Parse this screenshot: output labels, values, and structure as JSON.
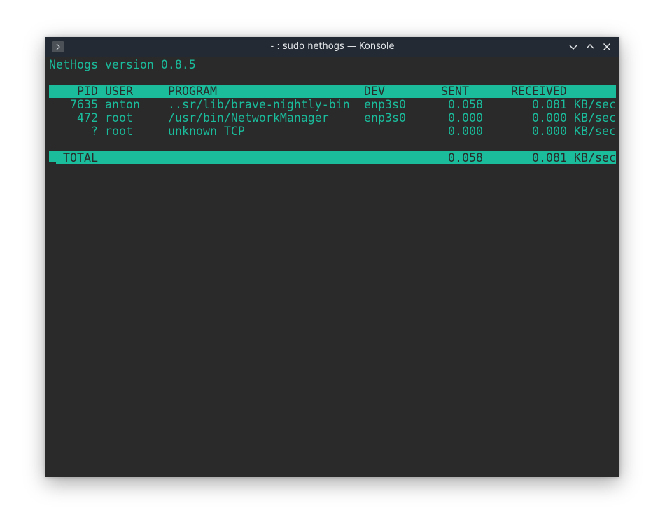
{
  "window": {
    "title": "- : sudo nethogs — Konsole",
    "accent": "#1abc9c",
    "background": "#2a2a2a",
    "titlebar_color": "#232a33"
  },
  "icons": {
    "app": "terminal-prompt-icon",
    "minimize": "chevron-down-icon",
    "maximize": "chevron-up-icon",
    "close": "close-icon"
  },
  "terminal": {
    "version_line": "NetHogs version 0.8.5",
    "headers": {
      "pid": "PID",
      "user": "USER",
      "program": "PROGRAM",
      "dev": "DEV",
      "sent": "SENT",
      "received": "RECEIVED"
    },
    "rows": [
      {
        "pid": "7635",
        "user": "anton",
        "program": "..sr/lib/brave-nightly-bin",
        "dev": "enp3s0",
        "sent": "0.058",
        "received": "0.081",
        "unit": "KB/sec"
      },
      {
        "pid": "472",
        "user": "root",
        "program": "/usr/bin/NetworkManager",
        "dev": "enp3s0",
        "sent": "0.000",
        "received": "0.000",
        "unit": "KB/sec"
      },
      {
        "pid": "?",
        "user": "root",
        "program": "unknown TCP",
        "dev": "",
        "sent": "0.000",
        "received": "0.000",
        "unit": "KB/sec"
      }
    ],
    "total": {
      "label": "TOTAL",
      "sent": "0.058",
      "received": "0.081",
      "unit": "KB/sec"
    }
  }
}
